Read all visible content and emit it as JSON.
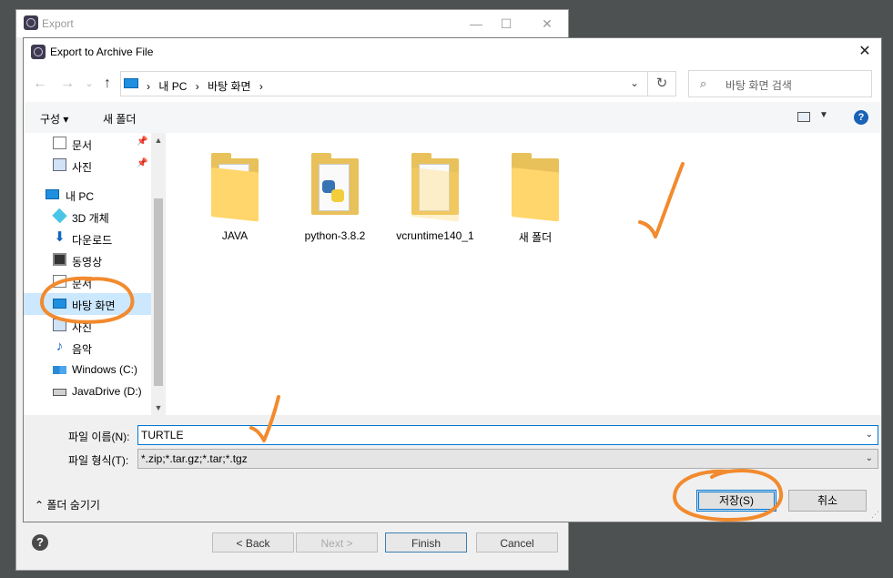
{
  "background_window": {
    "title": "Export",
    "minimize_glyph": "—",
    "maximize_glyph": "☐",
    "close_glyph": "✕",
    "help_glyph": "?",
    "buttons": {
      "back": "< Back",
      "next": "Next >",
      "finish": "Finish",
      "cancel": "Cancel"
    }
  },
  "dialog": {
    "title": "Export to Archive File",
    "close_glyph": "✕",
    "nav": {
      "back_glyph": "←",
      "forward_glyph": "→",
      "recent_glyph": "⌄",
      "up_glyph": "↑",
      "crumb_sep": "›",
      "breadcrumbs": [
        "내 PC",
        "바탕 화면"
      ],
      "dropdown_glyph": "⌄",
      "refresh_glyph": "↻",
      "search_glyph": "⌕",
      "search_placeholder": "바탕 화면 검색"
    },
    "command_bar": {
      "organize": "구성 ▾",
      "new_folder": "새 폴더",
      "view_dropdown_glyph": "▼",
      "help_glyph": "?"
    },
    "nav_pane": {
      "pin_glyph": "📌",
      "scroll_up_glyph": "▲",
      "scroll_down_glyph": "▼",
      "items": [
        {
          "label": "문서",
          "icon": "document-icon",
          "pinned": true
        },
        {
          "label": "사진",
          "icon": "pictures-icon",
          "pinned": true
        },
        {
          "label": "내 PC",
          "icon": "pc-icon"
        },
        {
          "label": "3D 개체",
          "icon": "3d-objects-icon"
        },
        {
          "label": "다운로드",
          "icon": "download-icon"
        },
        {
          "label": "동영상",
          "icon": "video-icon"
        },
        {
          "label": "문서",
          "icon": "document-icon"
        },
        {
          "label": "바탕 화면",
          "icon": "desktop-icon",
          "selected": true
        },
        {
          "label": "사진",
          "icon": "pictures-icon"
        },
        {
          "label": "음악",
          "icon": "music-icon"
        },
        {
          "label": "Windows (C:)",
          "icon": "windows-drive-icon"
        },
        {
          "label": "JavaDrive (D:)",
          "icon": "drive-icon"
        }
      ]
    },
    "folders": [
      {
        "name": "JAVA"
      },
      {
        "name": "python-3.8.2"
      },
      {
        "name": "vcruntime140_1"
      },
      {
        "name": "새 폴더"
      }
    ],
    "file_name_label": "파일 이름(N):",
    "file_name_value": "TURTLE",
    "file_type_label": "파일 형식(T):",
    "file_type_value": "*.zip;*.tar.gz;*.tar;*.tgz",
    "combo_dropdown_glyph": "⌄",
    "hide_folders": "⌃  폴더 숨기기",
    "save_button": "저장(S)",
    "cancel_button": "취소",
    "grip_glyph": "⋰"
  },
  "colors": {
    "annotation": "#f28a2e",
    "selection": "#cce8ff",
    "focus_border": "#0078d7"
  }
}
